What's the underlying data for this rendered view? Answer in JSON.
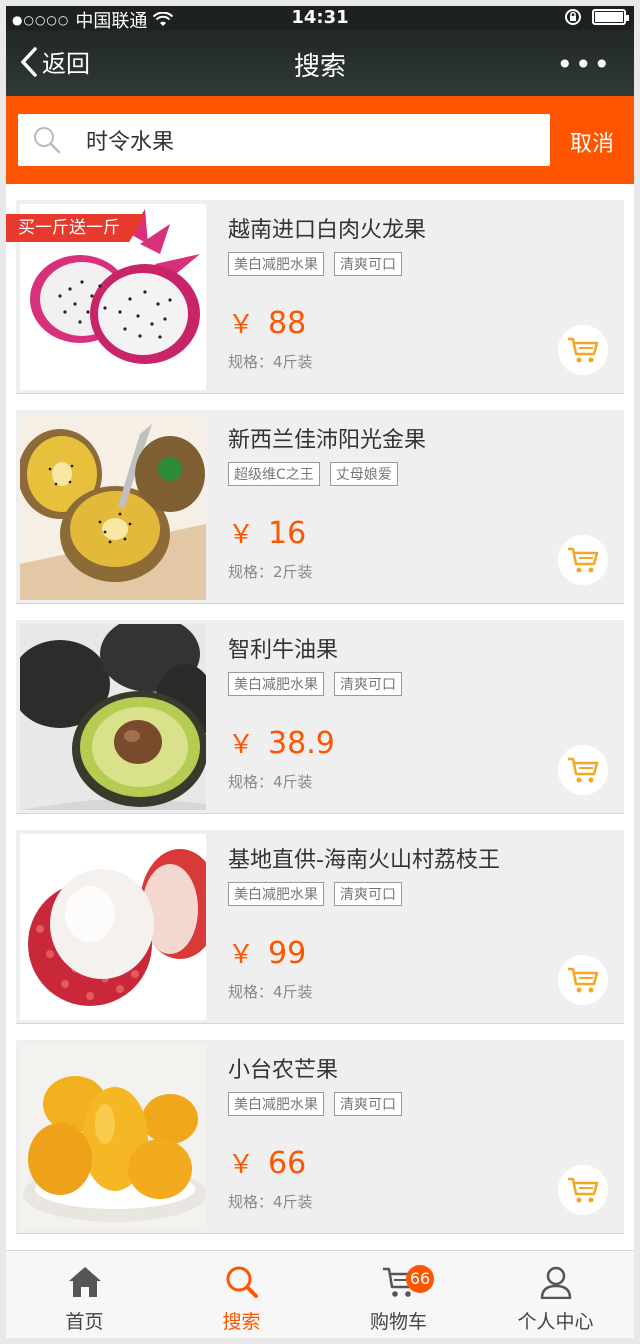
{
  "status_bar": {
    "carrier": "中国联通",
    "signal": "●○○○○",
    "time": "14:31"
  },
  "nav": {
    "back_label": "返回",
    "title": "搜索"
  },
  "search": {
    "query": "时令水果",
    "cancel_label": "取消"
  },
  "colors": {
    "accent": "#ff5500",
    "promo": "#e8392d",
    "cart_icon": "#f5a623"
  },
  "products": [
    {
      "name": "越南进口白肉火龙果",
      "tags": [
        "美白减肥水果",
        "清爽可口"
      ],
      "currency": "￥",
      "price": "88",
      "spec": "规格：4斤装",
      "promo": "买一斤送一斤",
      "image": "dragon-fruit"
    },
    {
      "name": "新西兰佳沛阳光金果",
      "tags": [
        "超级维C之王",
        "丈母娘爱"
      ],
      "currency": "￥",
      "price": "16",
      "spec": "规格：2斤装",
      "promo": "",
      "image": "golden-kiwi"
    },
    {
      "name": "智利牛油果",
      "tags": [
        "美白减肥水果",
        "清爽可口"
      ],
      "currency": "￥",
      "price": "38.9",
      "spec": "规格：4斤装",
      "promo": "",
      "image": "avocado"
    },
    {
      "name": "基地直供-海南火山村荔枝王",
      "tags": [
        "美白减肥水果",
        "清爽可口"
      ],
      "currency": "￥",
      "price": "99",
      "spec": "规格：4斤装",
      "promo": "",
      "image": "lychee"
    },
    {
      "name": "小台农芒果",
      "tags": [
        "美白减肥水果",
        "清爽可口"
      ],
      "currency": "￥",
      "price": "66",
      "spec": "规格：4斤装",
      "promo": "",
      "image": "mango"
    }
  ],
  "tabbar": {
    "tabs": [
      {
        "label": "首页",
        "icon": "home-icon",
        "active": false
      },
      {
        "label": "搜索",
        "icon": "search-icon",
        "active": true
      },
      {
        "label": "购物车",
        "icon": "cart-icon",
        "active": false,
        "badge": "66"
      },
      {
        "label": "个人中心",
        "icon": "user-icon",
        "active": false
      }
    ]
  }
}
